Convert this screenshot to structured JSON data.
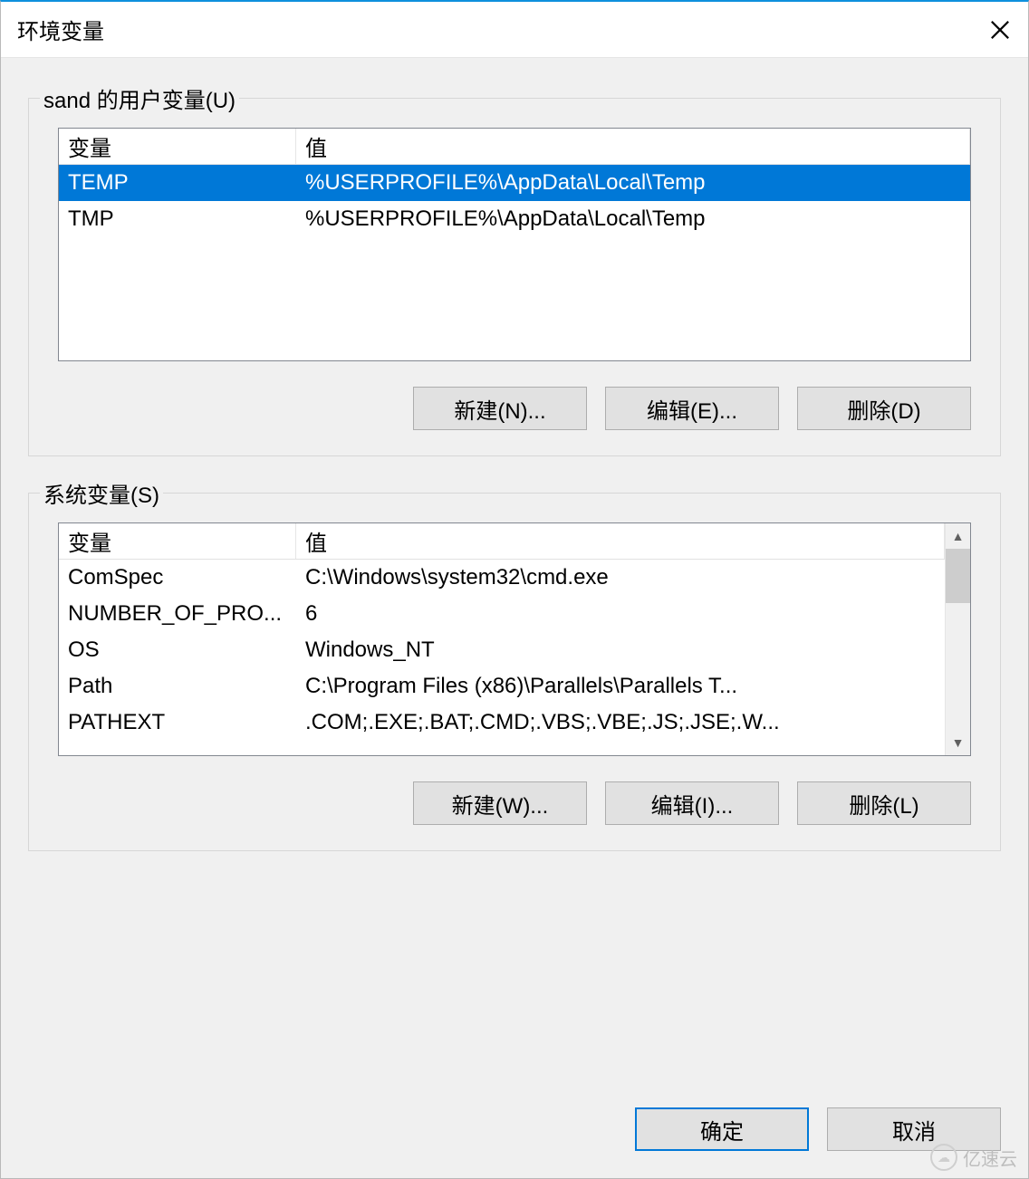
{
  "window": {
    "title": "环境变量"
  },
  "user_group": {
    "label": "sand 的用户变量(U)",
    "columns": {
      "name": "变量",
      "value": "值"
    },
    "rows": [
      {
        "name": "TEMP",
        "value": "%USERPROFILE%\\AppData\\Local\\Temp",
        "selected": true
      },
      {
        "name": "TMP",
        "value": "%USERPROFILE%\\AppData\\Local\\Temp",
        "selected": false
      }
    ],
    "buttons": {
      "new": "新建(N)...",
      "edit": "编辑(E)...",
      "delete": "删除(D)"
    }
  },
  "system_group": {
    "label": "系统变量(S)",
    "columns": {
      "name": "变量",
      "value": "值"
    },
    "rows": [
      {
        "name": "ComSpec",
        "value": "C:\\Windows\\system32\\cmd.exe"
      },
      {
        "name": "NUMBER_OF_PRO...",
        "value": "6"
      },
      {
        "name": "OS",
        "value": "Windows_NT"
      },
      {
        "name": "Path",
        "value": "C:\\Program Files (x86)\\Parallels\\Parallels T..."
      },
      {
        "name": "PATHEXT",
        "value": ".COM;.EXE;.BAT;.CMD;.VBS;.VBE;.JS;.JSE;.W..."
      }
    ],
    "buttons": {
      "new": "新建(W)...",
      "edit": "编辑(I)...",
      "delete": "删除(L)"
    }
  },
  "footer": {
    "ok": "确定",
    "cancel": "取消"
  },
  "watermark": {
    "text": "亿速云"
  }
}
